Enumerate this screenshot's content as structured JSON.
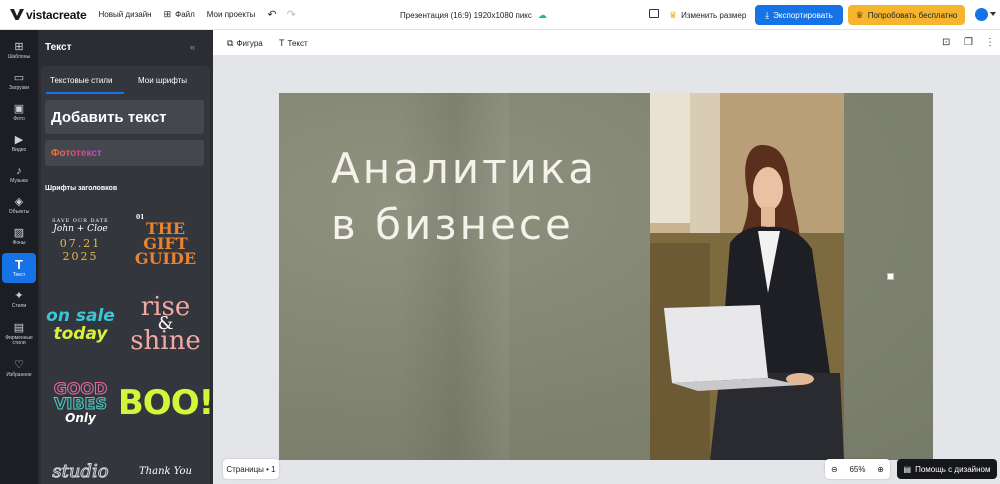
{
  "header": {
    "logo": "vistacreate",
    "nav": [
      {
        "label": "Новый дизайн",
        "icon": "none"
      },
      {
        "label": "Файл",
        "icon": "grid-icon"
      },
      {
        "label": "Мои проекты",
        "icon": "none"
      }
    ],
    "doc_title": "Презентация (16:9) 1920x1080  пикс",
    "resize_label": "Изменить размер",
    "export_label": "Экспортировать",
    "trial_label": "Попробовать бесплатно",
    "colors": {
      "primary": "#1673e6",
      "trial": "#f6b52f"
    }
  },
  "rail": [
    {
      "label": "Шаблоны",
      "icon": "⊞"
    },
    {
      "label": "Загрузки",
      "icon": "▭"
    },
    {
      "label": "Фото",
      "icon": "▣"
    },
    {
      "label": "Видео",
      "icon": "▶"
    },
    {
      "label": "Музыка",
      "icon": "♪"
    },
    {
      "label": "Объекты",
      "icon": "◈"
    },
    {
      "label": "Фоны",
      "icon": "▨"
    },
    {
      "label": "Текст",
      "icon": "T"
    },
    {
      "label": "Стили",
      "icon": "✦"
    },
    {
      "label": "Фирменные стили",
      "icon": "▤"
    },
    {
      "label": "Избранное",
      "icon": "♡"
    }
  ],
  "panel": {
    "title": "Текст",
    "tabs": [
      "Текстовые стили",
      "Мои шрифты"
    ],
    "add_text": "Добавить текст",
    "photo_text": "Фототекст",
    "section_title": "Шрифты заголовков",
    "thumbs": [
      {
        "line1": "SAVE OUR DATE",
        "line2": "John + Cloe",
        "line3": "07.21",
        "line4": "2025"
      },
      {
        "line1": "01",
        "line2": "THE",
        "line3": "GIFT",
        "line4": "GUIDE"
      },
      {
        "line1": "on sale",
        "line2": "today"
      },
      {
        "line1": "rise",
        "line2": "&",
        "line3": "shine"
      },
      {
        "line1": "GOOD",
        "line2": "VIBES",
        "line3": "Only"
      },
      {
        "line1": "BOO!"
      },
      {
        "line1": "studio"
      },
      {
        "line1": "Thank You"
      }
    ]
  },
  "toolbar": {
    "shape_label": "Фигура",
    "text_label": "Текст"
  },
  "slide": {
    "headline_line1": "Аналитика",
    "headline_line2": "в бизнесе"
  },
  "footer": {
    "pages_label": "Страницы • 1",
    "zoom_value": "65%",
    "help_label": "Помощь с дизайном"
  }
}
